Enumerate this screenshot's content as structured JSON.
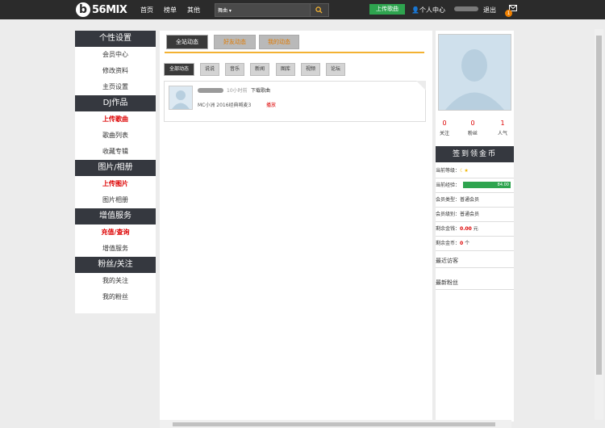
{
  "header": {
    "logo_text": "56MIX",
    "logo_sub": "DJ音乐网",
    "nav": [
      "首页",
      "榜单",
      "其他"
    ],
    "search_select": "舞曲",
    "upload_label": "上传歌曲",
    "user_center": "个人中心",
    "logout": "退出",
    "mail_badge": "1"
  },
  "sidebar": {
    "sections": [
      {
        "title": "个性设置",
        "items": [
          {
            "label": "会员中心",
            "red": false
          },
          {
            "label": "修改资料",
            "red": false
          },
          {
            "label": "主页设置",
            "red": false
          }
        ]
      },
      {
        "title": "DJ作品",
        "items": [
          {
            "label": "上传歌曲",
            "red": true
          },
          {
            "label": "歌曲列表",
            "red": false
          },
          {
            "label": "收藏专辑",
            "red": false
          }
        ]
      },
      {
        "title": "图片/相册",
        "items": [
          {
            "label": "上传图片",
            "red": true
          },
          {
            "label": "图片相册",
            "red": false
          }
        ]
      },
      {
        "title": "增值服务",
        "items": [
          {
            "label": "充值/查询",
            "red": true
          },
          {
            "label": "增值服务",
            "red": false
          }
        ]
      },
      {
        "title": "粉丝/关注",
        "items": [
          {
            "label": "我的关注",
            "red": false
          },
          {
            "label": "我的粉丝",
            "red": false
          }
        ]
      }
    ]
  },
  "main": {
    "feed_tabs": [
      "全站动态",
      "好友动态",
      "我的动态"
    ],
    "category_tabs": [
      "全部动态",
      "说说",
      "音乐",
      "新闻",
      "图库",
      "视频",
      "论坛"
    ],
    "feed": {
      "time": "10小时前",
      "action": "下载歌曲",
      "song": "MC小洲 2016经典喊麦3",
      "play": "播放"
    }
  },
  "profile": {
    "stats": [
      {
        "value": "0",
        "label": "关注"
      },
      {
        "value": "0",
        "label": "粉丝"
      },
      {
        "value": "1",
        "label": "人气"
      }
    ],
    "checkin_label": "签到领金币",
    "level_label": "当前等级：",
    "exp_label": "当前经验：",
    "exp_value": "84.00",
    "exp_fraction": 1.0,
    "member_type_label": "会员类型：",
    "member_type": "普通会员",
    "member_level_label": "会员级别：",
    "member_level": "普通会员",
    "balance_label": "剩余金钱：",
    "balance": "0.00",
    "balance_unit": "元",
    "coins_label": "剩余金币：",
    "coins": "0",
    "coins_unit": "个",
    "recent_visitors": "最近访客",
    "new_fans": "最新粉丝"
  },
  "colors": {
    "accent": "#f3b233",
    "green": "#2ea44f",
    "dark": "#35383f",
    "red": "#dd0000"
  }
}
